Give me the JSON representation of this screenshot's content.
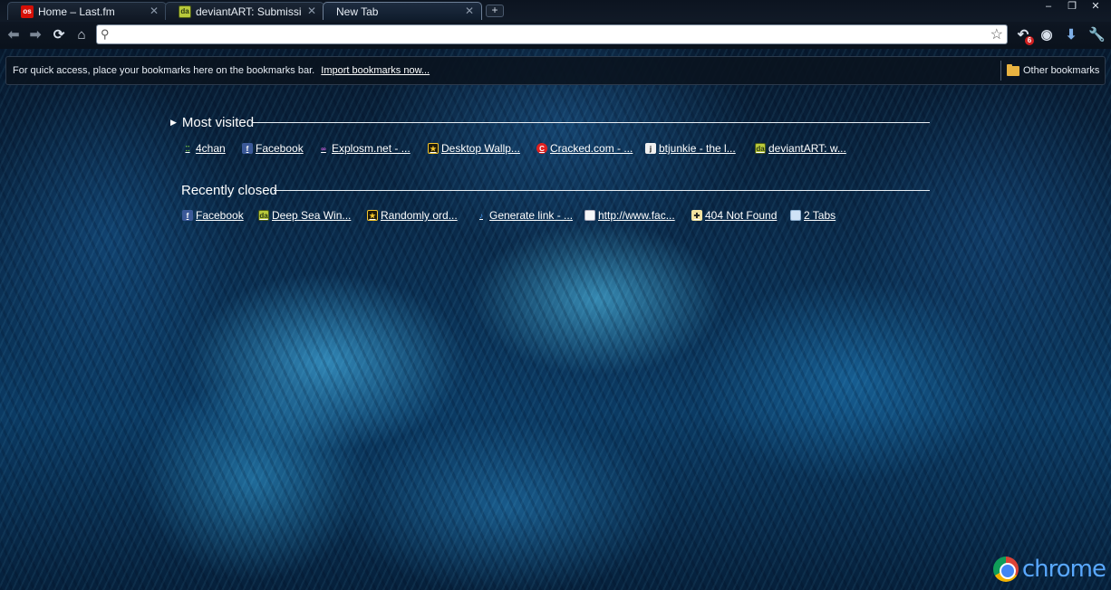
{
  "tabs": [
    {
      "label": "Home – Last.fm",
      "favicon": "lastfm-icon",
      "active": false
    },
    {
      "label": "deviantART: Submission",
      "favicon": "deviantart-icon",
      "active": false
    },
    {
      "label": "New Tab",
      "favicon": "",
      "active": true
    }
  ],
  "newtab_symbol": "+",
  "window": {
    "minimize": "–",
    "restore": "❐",
    "close": "✕"
  },
  "omnibox": {
    "value": "",
    "placeholder": ""
  },
  "toolbar": {
    "badge_count": "6"
  },
  "bookmarks_bar": {
    "message": "For quick access, place your bookmarks here on the bookmarks bar.",
    "import_link": "Import bookmarks now...",
    "other_bookmarks": "Other bookmarks"
  },
  "most_visited": {
    "title": "Most visited",
    "items": [
      {
        "label": "4chan",
        "icon": "4chan-icon"
      },
      {
        "label": "Facebook",
        "icon": "facebook-icon"
      },
      {
        "label": "Explosm.net - ...",
        "icon": "explosm-icon"
      },
      {
        "label": "Desktop Wallp...",
        "icon": "star-icon"
      },
      {
        "label": "Cracked.com - ...",
        "icon": "cracked-icon"
      },
      {
        "label": "btjunkie - the l...",
        "icon": "btjunkie-icon"
      },
      {
        "label": "deviantART: w...",
        "icon": "deviantart-icon"
      }
    ]
  },
  "recently_closed": {
    "title": "Recently closed",
    "items": [
      {
        "label": "Facebook",
        "icon": "facebook-icon"
      },
      {
        "label": "Deep Sea Win...",
        "icon": "deviantart-icon"
      },
      {
        "label": "Randomly ord...",
        "icon": "star-icon"
      },
      {
        "label": "Generate link - ...",
        "icon": "music-note-icon"
      },
      {
        "label": "http://www.fac...",
        "icon": "page-icon"
      },
      {
        "label": "404 Not Found",
        "icon": "404-icon"
      },
      {
        "label": "2 Tabs",
        "icon": "tabs-icon"
      }
    ]
  },
  "branding": {
    "word": "chrome"
  }
}
